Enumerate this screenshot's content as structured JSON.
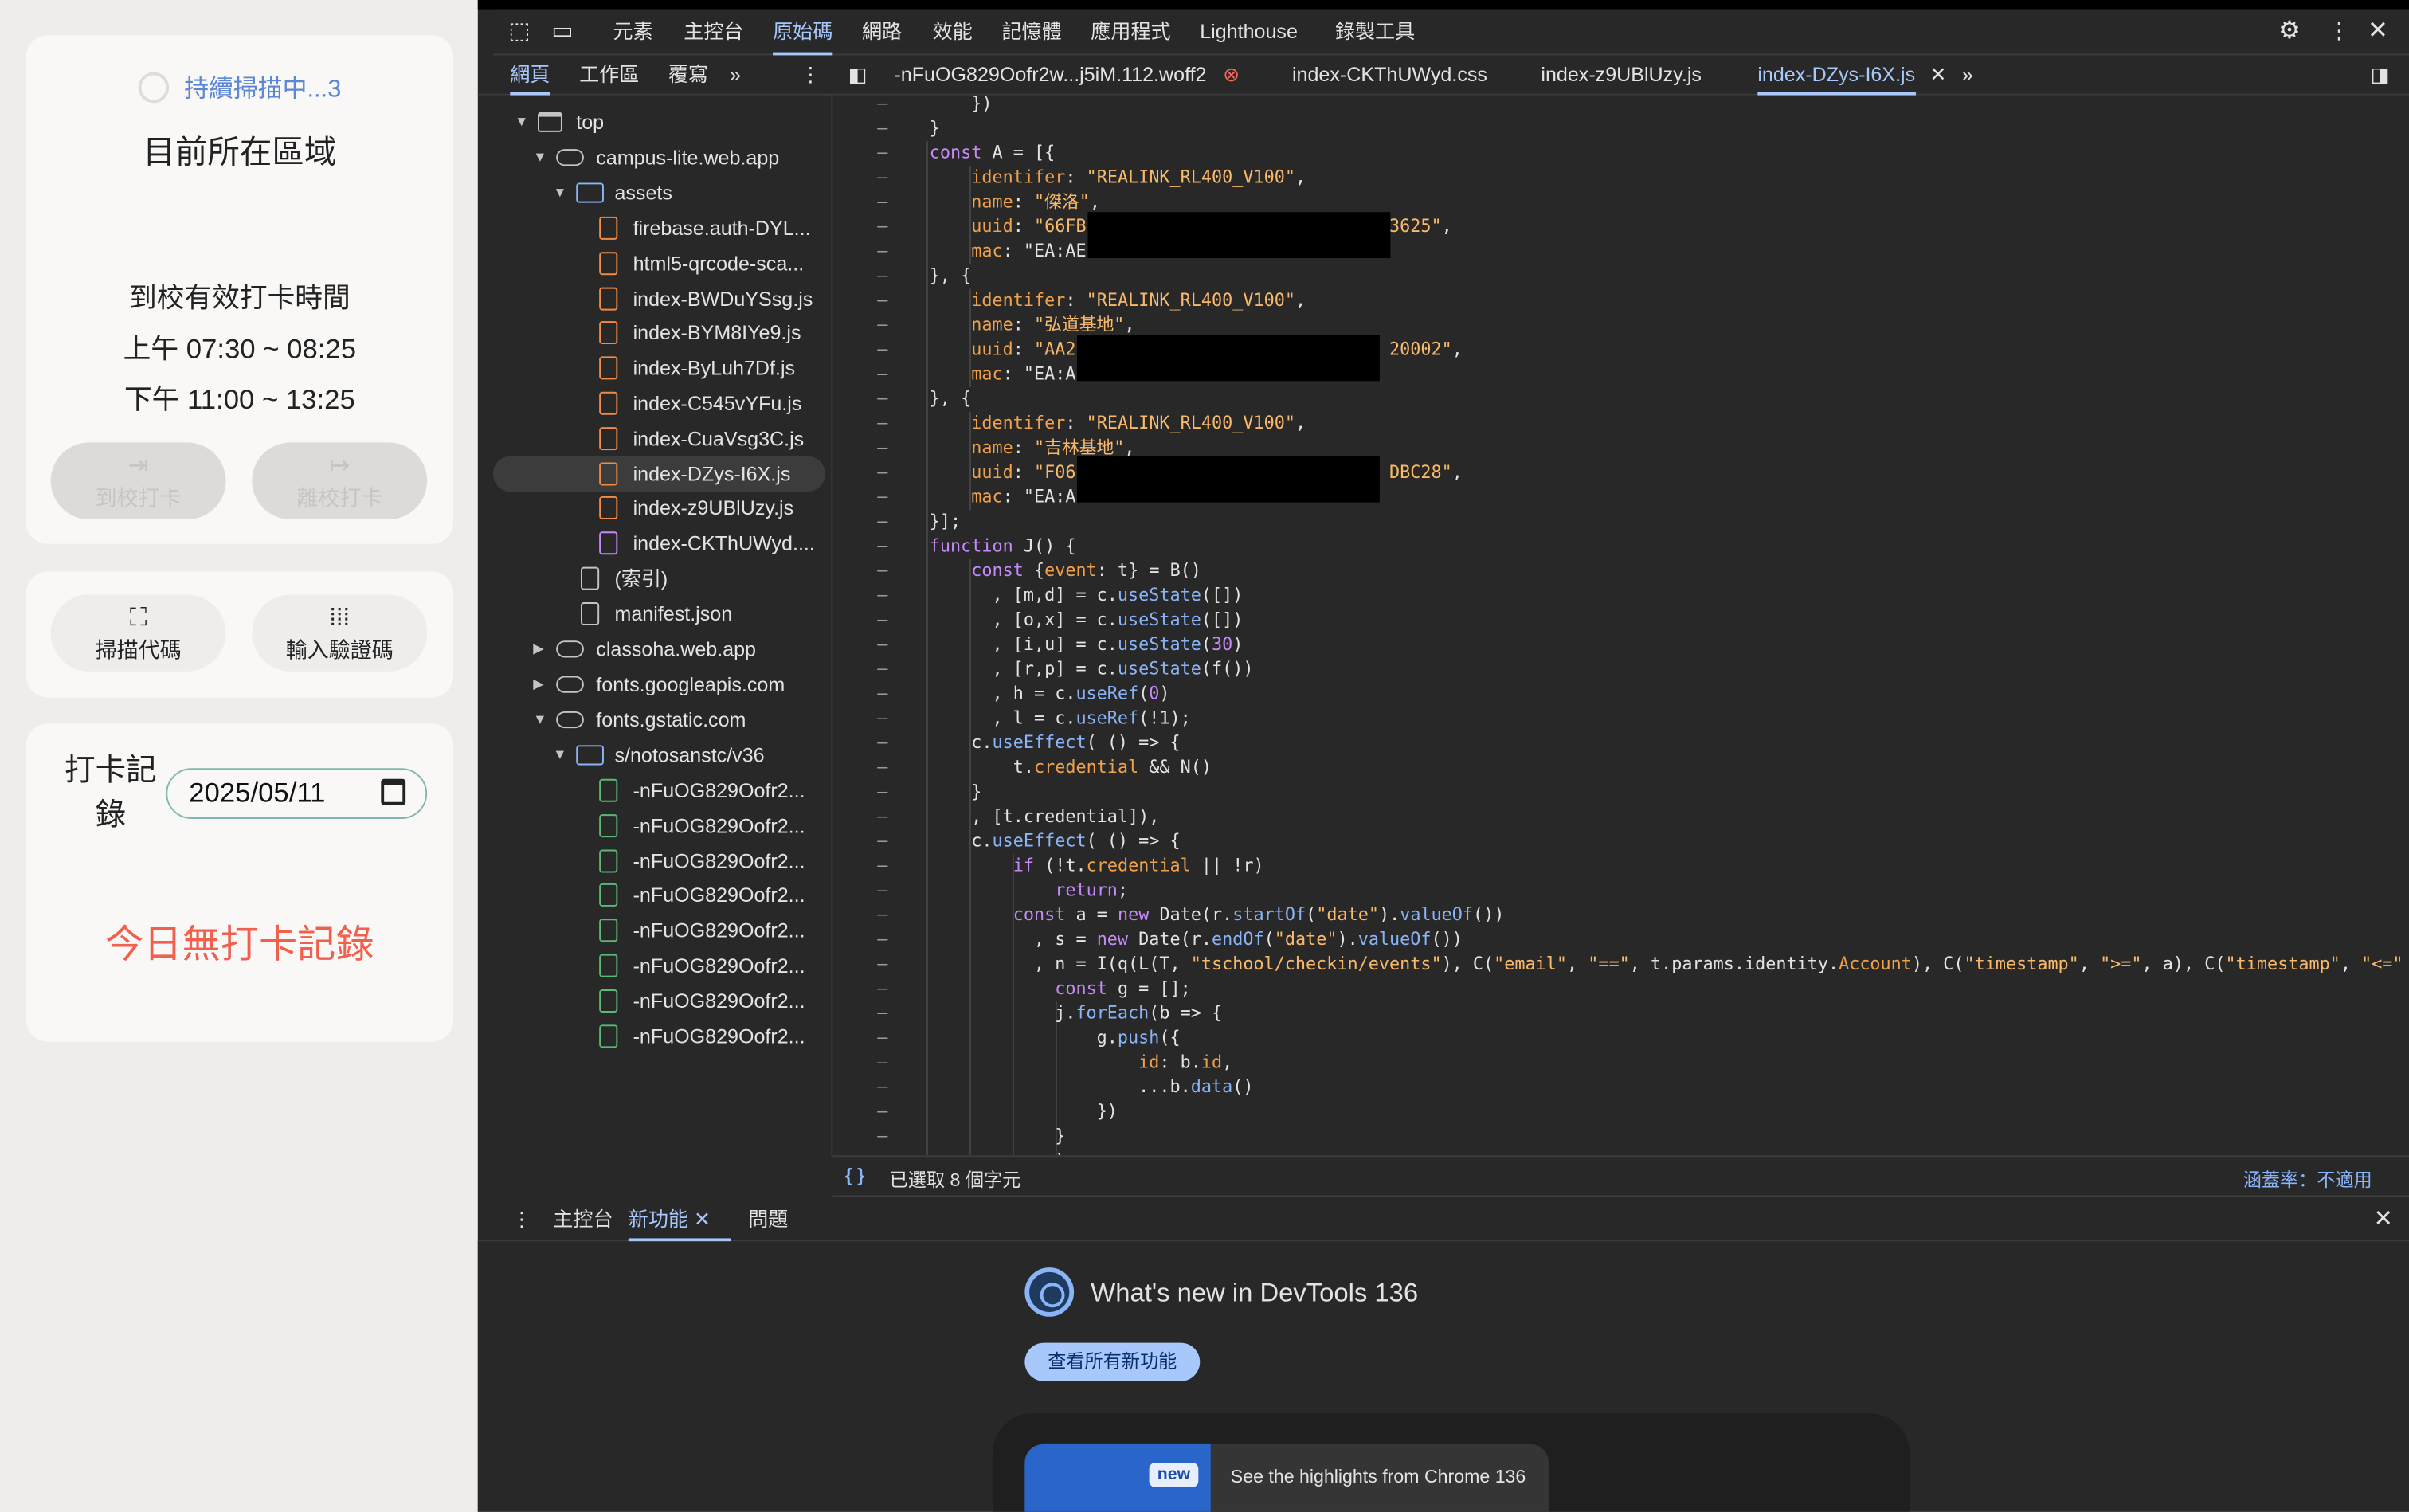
{
  "app": {
    "scan_status": "持續掃描中...3",
    "area_title": "目前所在區域",
    "checkin_title": "到校有效打卡時間",
    "morning": "上午 07:30 ~ 08:25",
    "noon": "下午 11:00 ~ 13:25",
    "arrive_btn": "到校打卡",
    "leave_btn": "離校打卡",
    "scan_btn": "掃描代碼",
    "code_btn": "輸入驗證碼",
    "record_label": "打卡記錄",
    "record_label_1": "打卡記",
    "record_label_2": "錄",
    "date": "2025/05/11",
    "no_record": "今日無打卡記錄",
    "colors": {
      "accent": "#5b86d6",
      "alert": "#f0604d"
    }
  },
  "devtools": {
    "tabs": [
      "元素",
      "主控台",
      "原始碼",
      "網路",
      "效能",
      "記憶體",
      "應用程式",
      "Lighthouse",
      "錄製工具"
    ],
    "selected_tab": "原始碼",
    "nav_tabs": [
      "網頁",
      "工作區",
      "覆寫"
    ],
    "file_tabs": [
      "-nFuOG829Oofr2w...j5iM.112.woff2",
      "index-CKThUWyd.css",
      "index-z9UBlUzy.js",
      "index-DZys-I6X.js"
    ],
    "tree": {
      "top": "top",
      "campus": "campus-lite.web.app",
      "assets": "assets",
      "asset_files": [
        "firebase.auth-DYL...",
        "html5-qrcode-sca...",
        "index-BWDuYSsg.js",
        "index-BYM8IYe9.js",
        "index-ByLuh7Df.js",
        "index-C545vYFu.js",
        "index-CuaVsg3C.js",
        "index-DZys-I6X.js",
        "index-z9UBlUzy.js",
        "index-CKThUWyd...."
      ],
      "index": "(索引)",
      "manifest": "manifest.json",
      "classoha": "classoha.web.app",
      "googleapis": "fonts.googleapis.com",
      "gstatic": "fonts.gstatic.com",
      "noto": "s/notosanstc/v36",
      "font_files": [
        "-nFuOG829Oofr2...",
        "-nFuOG829Oofr2...",
        "-nFuOG829Oofr2...",
        "-nFuOG829Oofr2...",
        "-nFuOG829Oofr2...",
        "-nFuOG829Oofr2...",
        "-nFuOG829Oofr2...",
        "-nFuOG829Oofr2..."
      ]
    },
    "code_lines": [
      "    })",
      "}",
      "const A = [{",
      "    identifer: \"REALINK_RL400_V100\",",
      "    name: \"傑洛\",",
      "    uuid: \"66FB                             3625\",",
      "    mac: \"EA:AE",
      "}, {",
      "    identifer: \"REALINK_RL400_V100\",",
      "    name: \"弘道基地\",",
      "    uuid: \"AA2                              20002\",",
      "    mac: \"EA:A",
      "}, {",
      "    identifer: \"REALINK_RL400_V100\",",
      "    name: \"吉林基地\",",
      "    uuid: \"F06                              DBC28\",",
      "    mac: \"EA:A",
      "}];",
      "function J() {",
      "    const {event: t} = B()",
      "      , [m,d] = c.useState([])",
      "      , [o,x] = c.useState([])",
      "      , [i,u] = c.useState(30)",
      "      , [r,p] = c.useState(f())",
      "      , h = c.useRef(0)",
      "      , l = c.useRef(!1);",
      "    c.useEffect( () => {",
      "        t.credential && N()",
      "    }",
      "    , [t.credential]),",
      "    c.useEffect( () => {",
      "        if (!t.credential || !r)",
      "            return;",
      "        const a = new Date(r.startOf(\"date\").valueOf())",
      "          , s = new Date(r.endOf(\"date\").valueOf())",
      "          , n = I(q(L(T, \"tschool/checkin/events\"), C(\"email\", \"==\", t.params.identity.Account), C(\"timestamp\", \">=\", a), C(\"timestamp\", \"<=\"",
      "            const g = [];",
      "            j.forEach(b => {",
      "                g.push({",
      "                    id: b.id,",
      "                    ...b.data()",
      "                })",
      "            }",
      "            )"
    ],
    "status_selected": "已選取 8 個字元",
    "coverage": "涵蓋率：不適用",
    "drawer_tabs": [
      "主控台",
      "新功能",
      "問題"
    ],
    "news_title": "What's new in DevTools 136",
    "news_button": "查看所有新功能",
    "badge_new": "new",
    "highlight": "See the highlights from Chrome 136"
  }
}
